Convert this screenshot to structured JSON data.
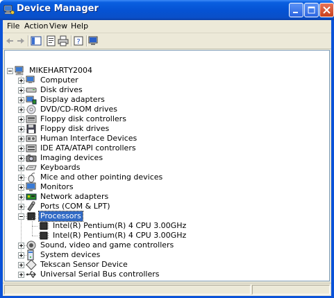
{
  "window": {
    "title": "Device Manager"
  },
  "menu": [
    "File",
    "Action",
    "View",
    "Help"
  ],
  "toolbar": [
    "back-arrow-icon",
    "forward-arrow-icon",
    "show-hide-icon",
    "properties-icon",
    "print-icon",
    "help-icon",
    "scan-hardware-icon"
  ],
  "tree": {
    "root": "MIKEHARTY2004",
    "categories": [
      {
        "label": "Computer",
        "icon": "computer-icon"
      },
      {
        "label": "Disk drives",
        "icon": "disk-drive-icon"
      },
      {
        "label": "Display adapters",
        "icon": "display-adapter-icon"
      },
      {
        "label": "DVD/CD-ROM drives",
        "icon": "cdrom-icon"
      },
      {
        "label": "Floppy disk controllers",
        "icon": "floppy-controller-icon"
      },
      {
        "label": "Floppy disk drives",
        "icon": "floppy-drive-icon"
      },
      {
        "label": "Human Interface Devices",
        "icon": "hid-icon"
      },
      {
        "label": "IDE ATA/ATAPI controllers",
        "icon": "ide-controller-icon"
      },
      {
        "label": "Imaging devices",
        "icon": "camera-icon"
      },
      {
        "label": "Keyboards",
        "icon": "keyboard-icon"
      },
      {
        "label": "Mice and other pointing devices",
        "icon": "mouse-icon"
      },
      {
        "label": "Monitors",
        "icon": "monitor-icon"
      },
      {
        "label": "Network adapters",
        "icon": "network-adapter-icon"
      },
      {
        "label": "Ports (COM & LPT)",
        "icon": "port-icon"
      },
      {
        "label": "Processors",
        "icon": "processor-icon",
        "expanded": true,
        "selected": true,
        "children": [
          "Intel(R) Pentium(R) 4 CPU 3.00GHz",
          "Intel(R) Pentium(R) 4 CPU 3.00GHz"
        ]
      },
      {
        "label": "Sound, video and game controllers",
        "icon": "sound-icon"
      },
      {
        "label": "System devices",
        "icon": "system-device-icon"
      },
      {
        "label": "Tekscan Sensor Device",
        "icon": "sensor-icon"
      },
      {
        "label": "Universal Serial Bus controllers",
        "icon": "usb-icon"
      }
    ]
  },
  "colors": {
    "titlebar": "#0553d4",
    "selection": "#316ac5",
    "chrome": "#ece9d8"
  }
}
